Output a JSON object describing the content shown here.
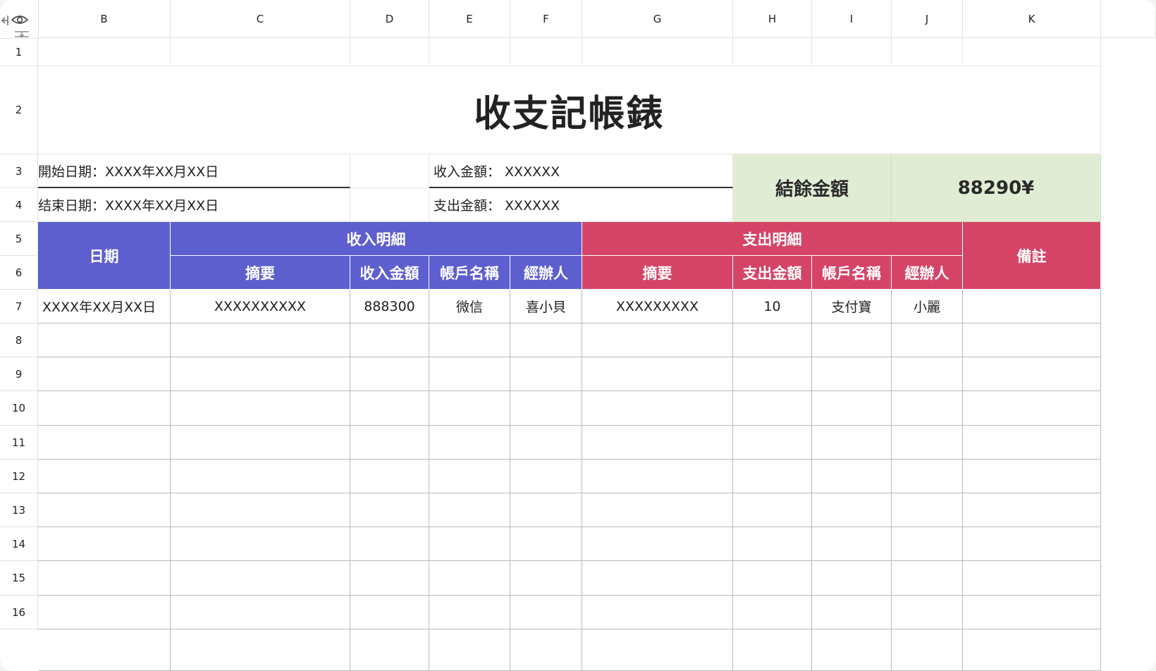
{
  "columns": [
    "B",
    "C",
    "D",
    "E",
    "F",
    "G",
    "H",
    "I",
    "J",
    "K"
  ],
  "rows": [
    "1",
    "2",
    "3",
    "4",
    "5",
    "6",
    "7",
    "8",
    "9",
    "10",
    "11",
    "12",
    "13",
    "14",
    "15",
    "16"
  ],
  "title": "收支記帳錶",
  "info": {
    "start_date": "開始日期：XXXX年XX月XX日",
    "end_date": "结束日期：XXXX年XX月XX日",
    "income_amount": "收入金額：  XXXXXX",
    "expense_amount": "支出金額：  XXXXXX",
    "balance_label": "結餘金額",
    "balance_value": "88290¥"
  },
  "headers": {
    "date": "日期",
    "income_group": "收入明細",
    "expense_group": "支出明細",
    "remarks": "備註",
    "income_cols": [
      "摘要",
      "收入金額",
      "帳戶名稱",
      "經辦人"
    ],
    "expense_cols": [
      "摘要",
      "支出金額",
      "帳戶名稱",
      "經辦人"
    ]
  },
  "rows_data": [
    [
      "XXXX年XX月XX日",
      "XXXXXXXXXX",
      "888300",
      "微信",
      "喜小貝",
      "XXXXXXXXX",
      "10",
      "支付寶",
      "小麗",
      ""
    ]
  ],
  "colors": {
    "income_header": "#5d5fcf",
    "expense_header": "#d54467",
    "balance_bg": "#e1ecd4"
  },
  "icons": [
    "eye-icon",
    "collapse-left-icon",
    "row-resize-icon"
  ]
}
